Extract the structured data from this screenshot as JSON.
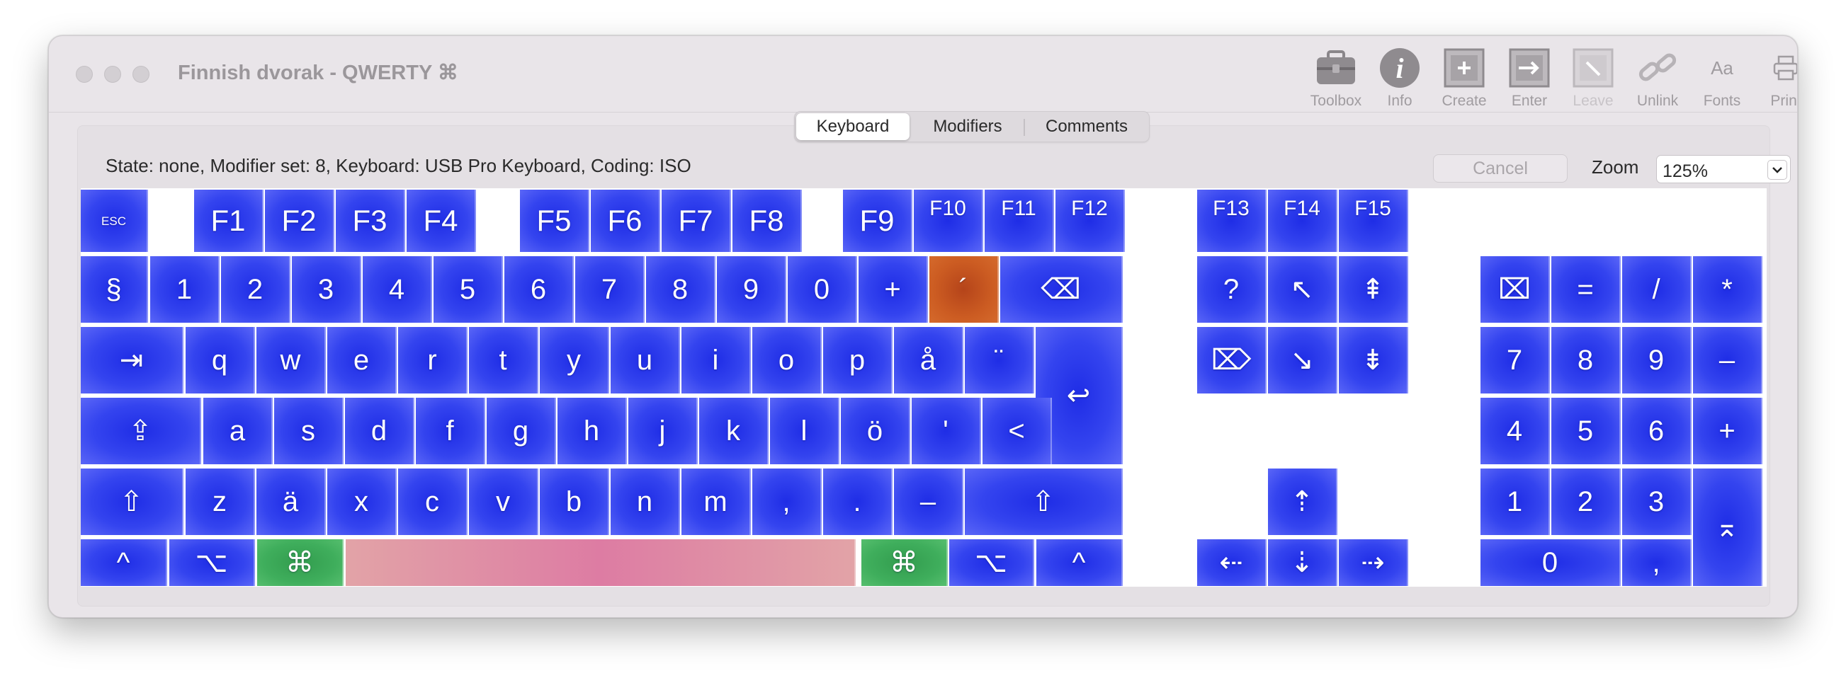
{
  "window": {
    "title": "Finnish dvorak - QWERTY ⌘"
  },
  "toolbar": {
    "items": [
      {
        "label": "Toolbox",
        "icon": "toolbox-icon",
        "enabled": true
      },
      {
        "label": "Info",
        "icon": "info-icon",
        "enabled": true
      },
      {
        "label": "Create",
        "icon": "create-icon",
        "enabled": true
      },
      {
        "label": "Enter",
        "icon": "enter-icon",
        "enabled": true
      },
      {
        "label": "Leave",
        "icon": "leave-icon",
        "enabled": false
      },
      {
        "label": "Unlink",
        "icon": "unlink-icon",
        "enabled": true
      },
      {
        "label": "Fonts",
        "icon": "fonts-icon",
        "enabled": true
      },
      {
        "label": "Print",
        "icon": "print-icon",
        "enabled": true
      }
    ],
    "fonts_glyph": "Aa"
  },
  "tabs": [
    {
      "label": "Keyboard",
      "active": true
    },
    {
      "label": "Modifiers",
      "active": false
    },
    {
      "label": "Comments",
      "active": false
    }
  ],
  "status": {
    "text": "State: none, Modifier set: 8, Keyboard: USB Pro Keyboard, Coding: ISO"
  },
  "controls": {
    "cancel_label": "Cancel",
    "zoom_label": "Zoom",
    "zoom_value": "125%"
  },
  "colors": {
    "key_blue": "#2a3aec",
    "key_highlight": "#c4531f",
    "key_command": "#3aa656",
    "key_space": "#de7fa5"
  },
  "keyboard": {
    "rows": {
      "function": [
        {
          "id": "esc",
          "label": "ESC"
        },
        {
          "id": "f1",
          "label": "F1"
        },
        {
          "id": "f2",
          "label": "F2"
        },
        {
          "id": "f3",
          "label": "F3"
        },
        {
          "id": "f4",
          "label": "F4"
        },
        {
          "id": "f5",
          "label": "F5"
        },
        {
          "id": "f6",
          "label": "F6"
        },
        {
          "id": "f7",
          "label": "F7"
        },
        {
          "id": "f8",
          "label": "F8"
        },
        {
          "id": "f9",
          "label": "F9"
        },
        {
          "id": "f10",
          "label": "F10"
        },
        {
          "id": "f11",
          "label": "F11"
        },
        {
          "id": "f12",
          "label": "F12"
        },
        {
          "id": "f13",
          "label": "F13"
        },
        {
          "id": "f14",
          "label": "F14"
        },
        {
          "id": "f15",
          "label": "F15"
        }
      ],
      "number": [
        {
          "id": "section",
          "label": "§"
        },
        {
          "id": "1",
          "label": "1"
        },
        {
          "id": "2",
          "label": "2"
        },
        {
          "id": "3",
          "label": "3"
        },
        {
          "id": "4",
          "label": "4"
        },
        {
          "id": "5",
          "label": "5"
        },
        {
          "id": "6",
          "label": "6"
        },
        {
          "id": "7",
          "label": "7"
        },
        {
          "id": "8",
          "label": "8"
        },
        {
          "id": "9",
          "label": "9"
        },
        {
          "id": "0",
          "label": "0"
        },
        {
          "id": "plus",
          "label": "+"
        },
        {
          "id": "acute",
          "label": "´",
          "state": "highlighted"
        },
        {
          "id": "delete",
          "label": "⌫"
        }
      ],
      "top": [
        {
          "id": "tab",
          "label": "⇥"
        },
        {
          "id": "q",
          "label": "q"
        },
        {
          "id": "w",
          "label": "w"
        },
        {
          "id": "e",
          "label": "e"
        },
        {
          "id": "r",
          "label": "r"
        },
        {
          "id": "t",
          "label": "t"
        },
        {
          "id": "y",
          "label": "y"
        },
        {
          "id": "u",
          "label": "u"
        },
        {
          "id": "i",
          "label": "i"
        },
        {
          "id": "o",
          "label": "o"
        },
        {
          "id": "p",
          "label": "p"
        },
        {
          "id": "aring",
          "label": "å"
        },
        {
          "id": "diaeresis",
          "label": "¨"
        },
        {
          "id": "return",
          "label": "↩"
        }
      ],
      "home": [
        {
          "id": "capslock",
          "label": "⇪"
        },
        {
          "id": "a",
          "label": "a"
        },
        {
          "id": "s",
          "label": "s"
        },
        {
          "id": "d",
          "label": "d"
        },
        {
          "id": "f",
          "label": "f"
        },
        {
          "id": "g",
          "label": "g"
        },
        {
          "id": "h",
          "label": "h"
        },
        {
          "id": "j",
          "label": "j"
        },
        {
          "id": "k",
          "label": "k"
        },
        {
          "id": "l",
          "label": "l"
        },
        {
          "id": "odiaeresis",
          "label": "ö"
        },
        {
          "id": "apostrophe",
          "label": "'"
        },
        {
          "id": "less",
          "label": "<"
        }
      ],
      "bottom": [
        {
          "id": "lshift",
          "label": "⇧"
        },
        {
          "id": "z",
          "label": "z"
        },
        {
          "id": "adiaeresis",
          "label": "ä"
        },
        {
          "id": "x",
          "label": "x"
        },
        {
          "id": "c",
          "label": "c"
        },
        {
          "id": "v",
          "label": "v"
        },
        {
          "id": "b",
          "label": "b"
        },
        {
          "id": "n",
          "label": "n"
        },
        {
          "id": "m",
          "label": "m"
        },
        {
          "id": "comma",
          "label": ","
        },
        {
          "id": "period",
          "label": "."
        },
        {
          "id": "minus",
          "label": "–"
        },
        {
          "id": "rshift",
          "label": "⇧"
        }
      ],
      "space": [
        {
          "id": "lctrl",
          "label": "^"
        },
        {
          "id": "lopt",
          "label": "⌥"
        },
        {
          "id": "lcmd",
          "label": "⌘",
          "state": "pressed"
        },
        {
          "id": "space",
          "label": "",
          "state": "pressed"
        },
        {
          "id": "rcmd",
          "label": "⌘",
          "state": "pressed"
        },
        {
          "id": "ropt",
          "label": "⌥"
        },
        {
          "id": "rctrl",
          "label": "^"
        }
      ]
    },
    "navigation": [
      {
        "id": "help",
        "label": "?"
      },
      {
        "id": "home",
        "label": "↖"
      },
      {
        "id": "pageup",
        "label": "⇞"
      },
      {
        "id": "fwddelete",
        "label": "⌦"
      },
      {
        "id": "end",
        "label": "↘"
      },
      {
        "id": "pagedown",
        "label": "⇟"
      },
      {
        "id": "up",
        "label": "⇡"
      },
      {
        "id": "left",
        "label": "⇠"
      },
      {
        "id": "down",
        "label": "⇣"
      },
      {
        "id": "right",
        "label": "⇢"
      }
    ],
    "keypad": [
      {
        "id": "kp-clear",
        "label": "⌧"
      },
      {
        "id": "kp-equals",
        "label": "="
      },
      {
        "id": "kp-divide",
        "label": "/"
      },
      {
        "id": "kp-multiply",
        "label": "*"
      },
      {
        "id": "kp-7",
        "label": "7"
      },
      {
        "id": "kp-8",
        "label": "8"
      },
      {
        "id": "kp-9",
        "label": "9"
      },
      {
        "id": "kp-minus",
        "label": "–"
      },
      {
        "id": "kp-4",
        "label": "4"
      },
      {
        "id": "kp-5",
        "label": "5"
      },
      {
        "id": "kp-6",
        "label": "6"
      },
      {
        "id": "kp-plus",
        "label": "+"
      },
      {
        "id": "kp-1",
        "label": "1"
      },
      {
        "id": "kp-2",
        "label": "2"
      },
      {
        "id": "kp-3",
        "label": "3"
      },
      {
        "id": "kp-enter",
        "label": "⌅"
      },
      {
        "id": "kp-0",
        "label": "0"
      },
      {
        "id": "kp-comma",
        "label": ","
      }
    ]
  }
}
